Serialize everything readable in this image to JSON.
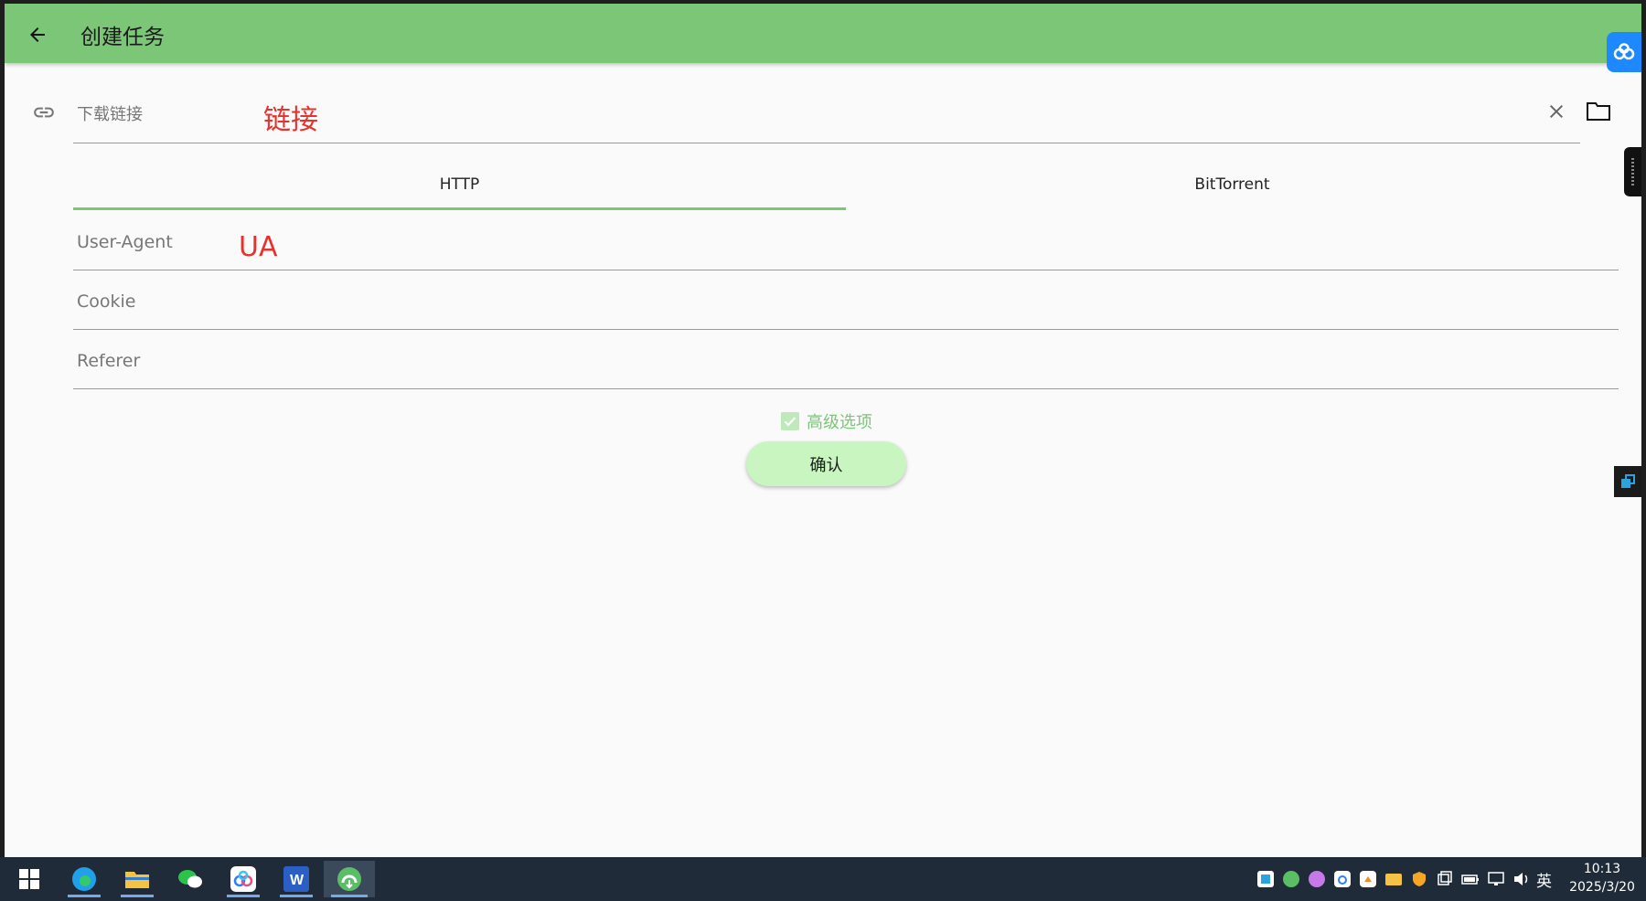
{
  "appbar": {
    "title": "创建任务"
  },
  "url_field": {
    "placeholder": "下载链接"
  },
  "annotations": {
    "link": "链接",
    "ua": "UA"
  },
  "tabs": [
    {
      "label": "HTTP",
      "active": true
    },
    {
      "label": "BitTorrent",
      "active": false
    }
  ],
  "fields": {
    "ua": "User-Agent",
    "cookie": "Cookie",
    "referer": "Referer"
  },
  "advanced": {
    "label": "高级选项",
    "checked": true
  },
  "confirm": {
    "label": "确认"
  },
  "taskbar": {
    "apps": [
      "windows-start-icon",
      "edge-icon",
      "file-explorer-icon",
      "wechat-icon",
      "baidu-netdisk-icon",
      "word-icon",
      "gopeed-icon"
    ],
    "ime": "英",
    "time": "10:13",
    "date": "2025/3/20"
  },
  "colors": {
    "primary": "#7bc677",
    "annotation": "#e8312c",
    "button": "#c8f5c0",
    "taskbar": "#1f2b38"
  }
}
